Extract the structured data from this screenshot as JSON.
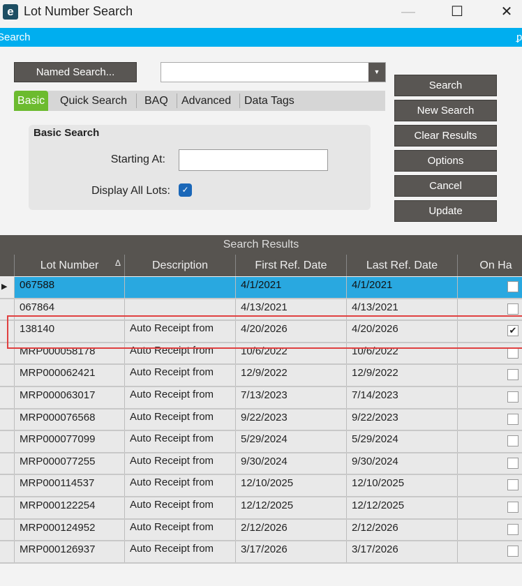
{
  "window": {
    "title": "Lot Number Search",
    "minimize": "—",
    "maximize": "☐",
    "close": "✕",
    "app_icon": "e"
  },
  "panel": {
    "title": "Search",
    "pin_icon": "ᵱ"
  },
  "named_search": {
    "label": "Named Search...",
    "combo_value": "",
    "arrow": "▼"
  },
  "tabs": [
    "Basic",
    "Quick Search",
    "BAQ",
    "Advanced",
    "Data Tags"
  ],
  "basic_search": {
    "title": "Basic Search",
    "starting_at_label": "Starting At:",
    "starting_at_value": "",
    "display_all_label": "Display All Lots:",
    "display_all_checked": true
  },
  "buttons": [
    "Search",
    "New Search",
    "Clear Results",
    "Options",
    "Cancel",
    "Update"
  ],
  "grid": {
    "title": "Search Results",
    "columns": [
      "Lot Number",
      "Description",
      "First Ref. Date",
      "Last Ref. Date",
      "On Ha"
    ],
    "sort_icon": "Δ",
    "rows": [
      {
        "lot": "067588",
        "desc": "",
        "first": "4/1/2021",
        "last": "4/1/2021",
        "on_hand": false,
        "selected": true
      },
      {
        "lot": "067864",
        "desc": "",
        "first": "4/13/2021",
        "last": "4/13/2021",
        "on_hand": false
      },
      {
        "lot": "138140",
        "desc": "Auto Receipt from",
        "first": "4/20/2026",
        "last": "4/20/2026",
        "on_hand": true
      },
      {
        "lot": "MRP000058178",
        "desc": "Auto Receipt from",
        "first": "10/6/2022",
        "last": "10/6/2022",
        "on_hand": false
      },
      {
        "lot": "MRP000062421",
        "desc": "Auto Receipt from",
        "first": "12/9/2022",
        "last": "12/9/2022",
        "on_hand": false
      },
      {
        "lot": "MRP000063017",
        "desc": "Auto Receipt from",
        "first": "7/13/2023",
        "last": "7/14/2023",
        "on_hand": false
      },
      {
        "lot": "MRP000076568",
        "desc": "Auto Receipt from",
        "first": "9/22/2023",
        "last": "9/22/2023",
        "on_hand": false
      },
      {
        "lot": "MRP000077099",
        "desc": "Auto Receipt from",
        "first": "5/29/2024",
        "last": "5/29/2024",
        "on_hand": false
      },
      {
        "lot": "MRP000077255",
        "desc": "Auto Receipt from",
        "first": "9/30/2024",
        "last": "9/30/2024",
        "on_hand": false
      },
      {
        "lot": "MRP000114537",
        "desc": "Auto Receipt from",
        "first": "12/10/2025",
        "last": "12/10/2025",
        "on_hand": false
      },
      {
        "lot": "MRP000122254",
        "desc": "Auto Receipt from",
        "first": "12/12/2025",
        "last": "12/12/2025",
        "on_hand": false
      },
      {
        "lot": "MRP000124952",
        "desc": "Auto Receipt from",
        "first": "2/12/2026",
        "last": "2/12/2026",
        "on_hand": false
      },
      {
        "lot": "MRP000126937",
        "desc": "Auto Receipt from",
        "first": "3/17/2026",
        "last": "3/17/2026",
        "on_hand": false
      }
    ]
  }
}
